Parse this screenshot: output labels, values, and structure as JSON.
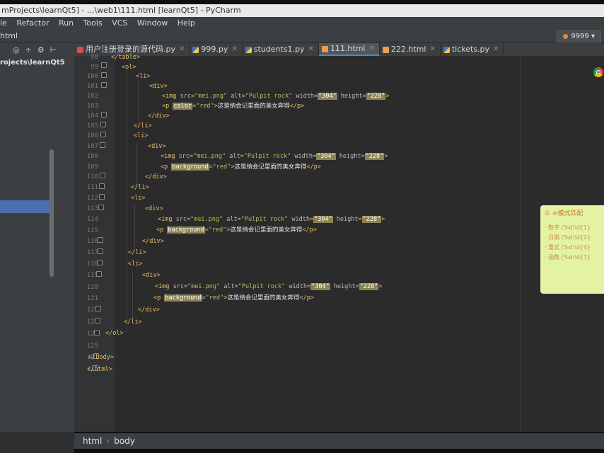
{
  "window": {
    "title": "mProjects\\learnQt5] - ...\\web1\\111.html [learnQt5] - PyCharm"
  },
  "menu": [
    "le",
    "Refactor",
    "Run",
    "Tools",
    "VCS",
    "Window",
    "Help"
  ],
  "nav": {
    "path": "html",
    "run_config": "9999"
  },
  "project": {
    "path": "rojects\\learnQt5"
  },
  "tabs": [
    {
      "label": "用户注册登录的源代码.py",
      "icon": "python-file-icon",
      "active": false
    },
    {
      "label": "999.py",
      "icon": "python-file-icon",
      "active": false
    },
    {
      "label": "students1.py",
      "icon": "python-file-icon",
      "active": false
    },
    {
      "label": "111.html",
      "icon": "html-file-icon",
      "active": true
    },
    {
      "label": "222.html",
      "icon": "html-file-icon",
      "active": false
    },
    {
      "label": "tickets.py",
      "icon": "python-file-icon",
      "active": false
    }
  ],
  "editor": {
    "line_numbers": [
      "98",
      "99",
      "100",
      "101",
      "102",
      "103",
      "104",
      "105",
      "106",
      "107",
      "108",
      "109",
      "110",
      "111",
      "112",
      "113",
      "114",
      "115",
      "116",
      "117",
      "118",
      "119",
      "120",
      "121",
      "122",
      "123",
      "124",
      "125",
      "126",
      "127"
    ]
  },
  "note": {
    "title": "① ≡模式匹配",
    "rows": [
      "· 数字 (%d:\\d{1}",
      "· 日期 (%d:\\d{2}",
      "· 重式 (%d:\\d{4}",
      "· 函数 (%d:\\d{7}"
    ]
  },
  "breadcrumb": {
    "items": [
      "html",
      "body"
    ]
  },
  "colors": {
    "tag": "#e8bf6a",
    "attr": "#bababa",
    "value": "#a5c25c",
    "editor_bg": "#2b2b2b",
    "accent": "#4a88c7"
  }
}
